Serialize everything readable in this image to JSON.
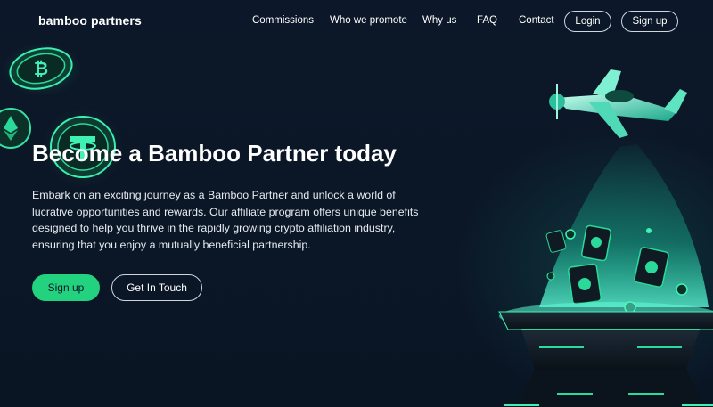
{
  "brand": {
    "logo_text": "bamboo partners"
  },
  "nav": {
    "items": [
      {
        "label": "Commissions"
      },
      {
        "label": "Who we promote"
      },
      {
        "label": "Why us"
      },
      {
        "label": "FAQ"
      },
      {
        "label": "Contact"
      }
    ],
    "login_label": "Login",
    "signup_label": "Sign up"
  },
  "hero": {
    "title": "Become a Bamboo Partner today",
    "description": "Embark on an exciting journey as a Bamboo Partner and unlock a world of lucrative opportunities and rewards. Our affiliate program offers unique benefits designed to help you thrive in the rapidly growing crypto affiliation industry, ensuring that you enjoy a mutually beneficial partnership.",
    "primary_button": "Sign up",
    "secondary_button": "Get In Touch"
  },
  "decor": {
    "coins": [
      "bitcoin-coin",
      "tether-coin",
      "ethereum-coin"
    ],
    "illustration": "airplane-over-glowing-pedestal"
  },
  "colors": {
    "background": "#0b1626",
    "accent_green": "#23d27f",
    "glow_teal": "#1ee6b4",
    "text": "#ffffff"
  }
}
